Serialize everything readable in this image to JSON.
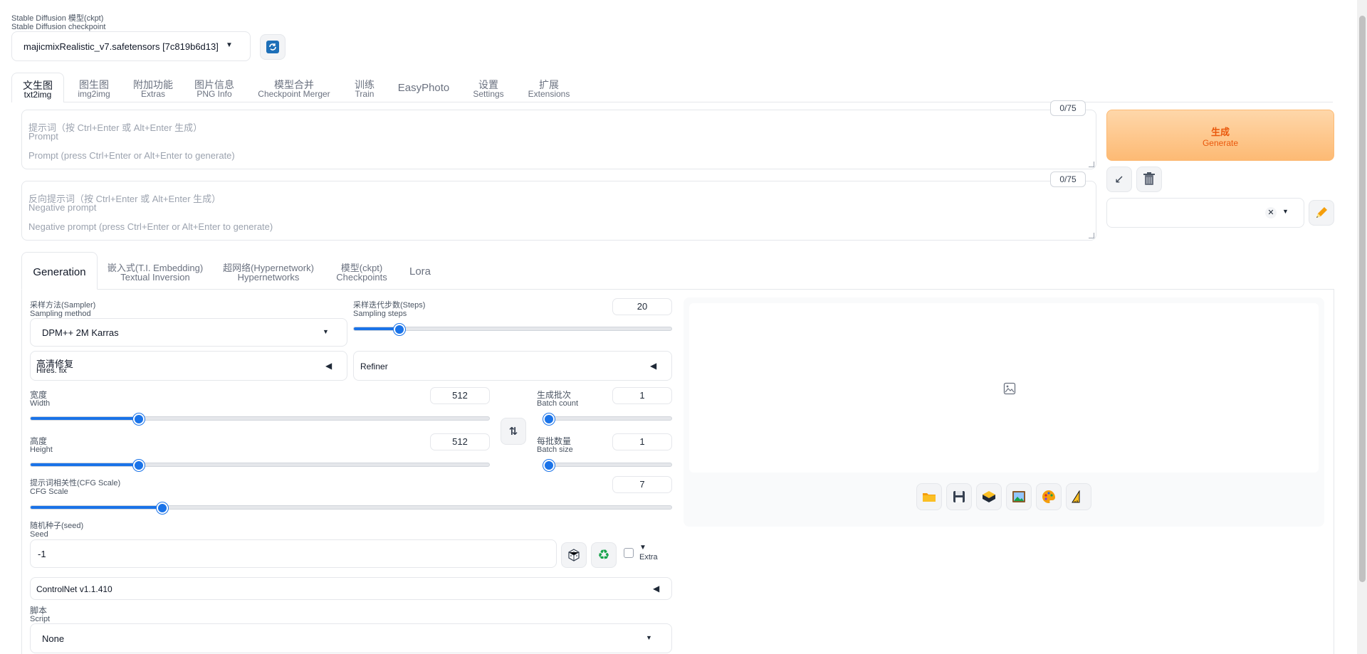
{
  "checkpoint": {
    "label_cn": "Stable Diffusion 模型(ckpt)",
    "label_en": "Stable Diffusion checkpoint",
    "value": "majicmixRealistic_v7.safetensors [7c819b6d13]"
  },
  "main_tabs": [
    {
      "cn": "文生图",
      "en": "txt2img"
    },
    {
      "cn": "图生图",
      "en": "img2img"
    },
    {
      "cn": "附加功能",
      "en": "Extras"
    },
    {
      "cn": "图片信息",
      "en": "PNG Info"
    },
    {
      "cn": "模型合并",
      "en": "Checkpoint Merger"
    },
    {
      "cn": "训练",
      "en": "Train"
    },
    {
      "cn": "EasyPhoto",
      "en": ""
    },
    {
      "cn": "设置",
      "en": "Settings"
    },
    {
      "cn": "扩展",
      "en": "Extensions"
    }
  ],
  "prompt": {
    "counter": "0/75",
    "label_cn": "提示词（按 Ctrl+Enter 或 Alt+Enter 生成）",
    "label_en": "Prompt",
    "placeholder": "Prompt (press Ctrl+Enter or Alt+Enter to generate)"
  },
  "negative_prompt": {
    "counter": "0/75",
    "label_cn": "反向提示词（按 Ctrl+Enter 或 Alt+Enter 生成）",
    "label_en": "Negative prompt",
    "placeholder": "Negative prompt (press Ctrl+Enter or Alt+Enter to generate)"
  },
  "generate": {
    "cn": "生成",
    "en": "Generate",
    "color": "#fdba74"
  },
  "sub_tabs": [
    {
      "cn": "Generation",
      "en": ""
    },
    {
      "cn": "嵌入式(T.I. Embedding)",
      "en": "Textual Inversion"
    },
    {
      "cn": "超网络(Hypernetwork)",
      "en": "Hypernetworks"
    },
    {
      "cn": "模型(ckpt)",
      "en": "Checkpoints"
    },
    {
      "cn": "Lora",
      "en": ""
    }
  ],
  "sampler": {
    "label_cn": "采样方法(Sampler)",
    "label_en": "Sampling method",
    "value": "DPM++ 2M Karras"
  },
  "steps": {
    "label_cn": "采样迭代步数(Steps)",
    "label_en": "Sampling steps",
    "value": "20",
    "fraction": 0.13
  },
  "hires": {
    "cn": "高清修复",
    "en": "Hires. fix"
  },
  "refiner": {
    "label": "Refiner"
  },
  "width": {
    "label_cn": "宽度",
    "label_en": "Width",
    "value": "512",
    "fraction": 0.23
  },
  "height": {
    "label_cn": "高度",
    "label_en": "Height",
    "value": "512",
    "fraction": 0.23
  },
  "batch_count": {
    "label_cn": "生成批次",
    "label_en": "Batch count",
    "value": "1",
    "fraction": 0.0
  },
  "batch_size": {
    "label_cn": "每批数量",
    "label_en": "Batch size",
    "value": "1",
    "fraction": 0.0
  },
  "cfg": {
    "label_cn": "提示词相关性(CFG Scale)",
    "label_en": "CFG Scale",
    "value": "7",
    "fraction": 0.2
  },
  "seed": {
    "label_cn": "随机种子(seed)",
    "label_en": "Seed",
    "value": "-1",
    "extra": "Extra"
  },
  "controlnet": {
    "label": "ControlNet v1.1.410"
  },
  "script": {
    "label_cn": "脚本",
    "label_en": "Script",
    "value": "None"
  },
  "icons": {
    "refresh": "refresh-icon",
    "swap": "swap-icon",
    "dice": "dice-icon",
    "recycle": "recycle-icon",
    "folder": "folder-icon",
    "save": "save-icon",
    "zip": "zip-icon",
    "image": "image-icon",
    "palette": "palette-icon",
    "ruler": "ruler-icon",
    "paste": "paste-arrow-icon",
    "trash": "trash-icon",
    "pencil": "pencil-icon"
  }
}
